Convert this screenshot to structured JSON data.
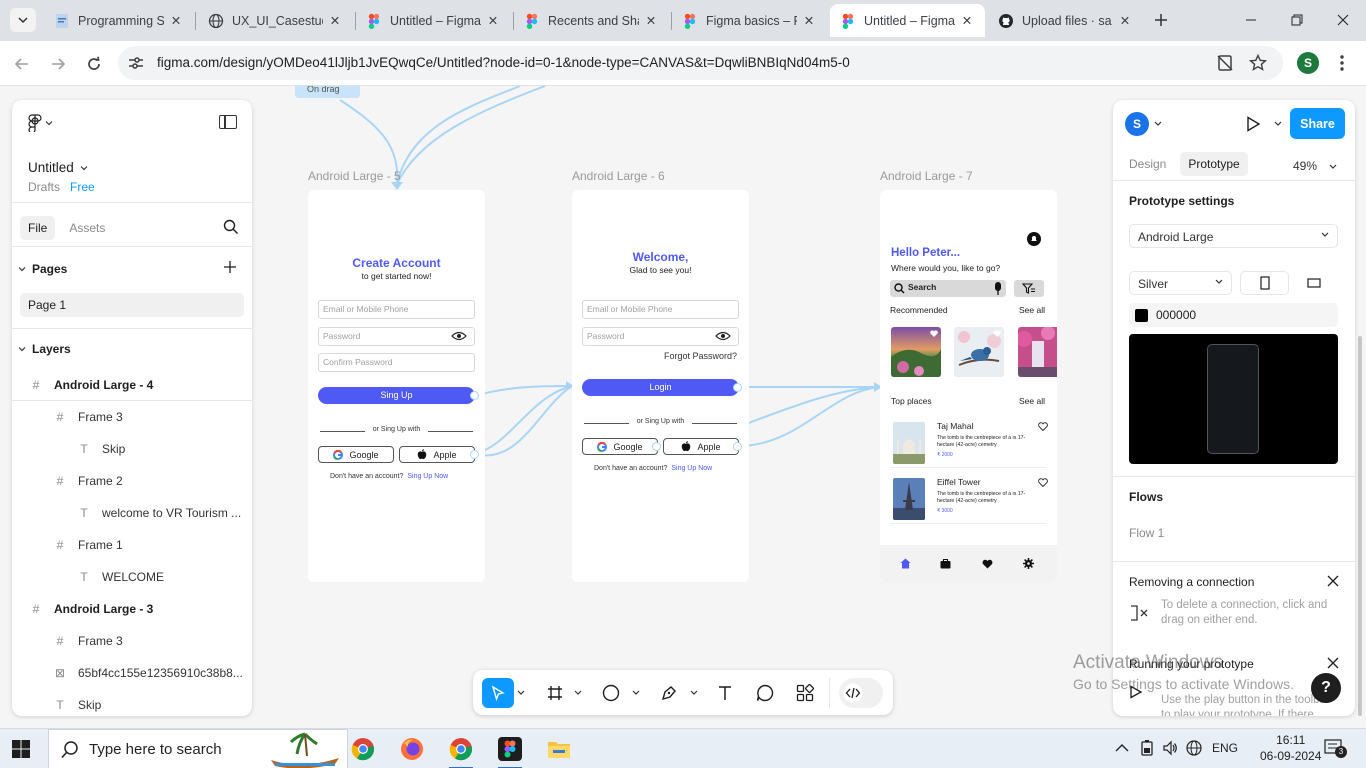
{
  "browser": {
    "tabs": [
      {
        "title": "Programming Sk",
        "icon": "generic-page-icon"
      },
      {
        "title": "UX_UI_Casestud",
        "icon": "globe-icon"
      },
      {
        "title": "Untitled – Figma",
        "icon": "figma-icon"
      },
      {
        "title": "Recents and Sha",
        "icon": "figma-icon"
      },
      {
        "title": "Figma basics – F",
        "icon": "figma-icon"
      },
      {
        "title": "Untitled – Figma",
        "icon": "figma-icon",
        "active": true
      },
      {
        "title": "Upload files · sa",
        "icon": "github-icon"
      }
    ],
    "url": "figma.com/design/yOMDeo41lJljb1JvEQwqCe/Untitled?node-id=0-1&node-type=CANVAS&t=DqwliBNBIqNd04m5-0",
    "profile_initial": "S"
  },
  "left_panel": {
    "file_name": "Untitled",
    "location": "Drafts",
    "plan": "Free",
    "tabs": [
      "File",
      "Assets"
    ],
    "pages_label": "Pages",
    "pages": [
      "Page 1"
    ],
    "layers_label": "Layers",
    "layers": [
      {
        "name": "Android Large - 4",
        "kind": "frame",
        "level": 0
      },
      {
        "name": "Frame 3",
        "kind": "frame",
        "level": 1
      },
      {
        "name": "Skip",
        "kind": "text",
        "level": 2
      },
      {
        "name": "Frame 2",
        "kind": "frame",
        "level": 1
      },
      {
        "name": "welcome to VR Tourism ...",
        "kind": "text",
        "level": 2
      },
      {
        "name": "Frame 1",
        "kind": "frame",
        "level": 1
      },
      {
        "name": "WELCOME",
        "kind": "text",
        "level": 2
      },
      {
        "name": "Android Large - 3",
        "kind": "frame",
        "level": 0
      },
      {
        "name": "Frame 3",
        "kind": "frame",
        "level": 1
      },
      {
        "name": "65bf4cc155e12356910c38b8...",
        "kind": "image",
        "level": 1
      },
      {
        "name": "Skip",
        "kind": "text",
        "level": 1
      }
    ]
  },
  "canvas": {
    "top_chip": "On drag",
    "frames": {
      "f5": {
        "label": "Android Large - 5",
        "title": "Create Account",
        "subtitle": "to get started now!",
        "email_placeholder": "Email or Mobile Phone",
        "password_placeholder": "Password",
        "confirm_placeholder": "Confirm Password",
        "primary_button": "Sing Up",
        "divider": "or Sing Up with",
        "google": "Google",
        "apple": "Apple",
        "footer_text": "Don't have an account?",
        "footer_link": "Sing Up Now"
      },
      "f6": {
        "label": "Android Large - 6",
        "title": "Welcome,",
        "subtitle": "Glad to see you!",
        "email_placeholder": "Email or Mobile Phone",
        "password_placeholder": "Password",
        "forgot": "Forgot Password?",
        "primary_button": "Login",
        "divider": "or Sing Up with",
        "google": "Google",
        "apple": "Apple",
        "footer_text": "Don't have an account?",
        "footer_link": "Sing Up Now"
      },
      "f7": {
        "label": "Android Large - 7",
        "greeting": "Hello Peter...",
        "question": "Where would you, like to go?",
        "search": "Search",
        "recommended": "Recommended",
        "see_all": "See all",
        "top_places": "Top places",
        "places": [
          {
            "name": "Taj Mahal",
            "desc": "The tomb is the centrepiece of a is 17-hectare (42-acre) cemetry",
            "price": "₹ 2000"
          },
          {
            "name": "Eiffel Tower",
            "desc": "The tomb is the centrepiece of a is 17-hectare (42-acre) cemetry",
            "price": "₹ 3000"
          }
        ],
        "nav_icons": [
          "home-icon",
          "bag-icon",
          "heart-icon",
          "gear-icon"
        ]
      }
    }
  },
  "toolbar_tools": [
    "move-tool",
    "frame-tool",
    "shape-tool",
    "pen-tool",
    "text-tool",
    "comment-tool",
    "actions-tool",
    "dev-mode-toggle"
  ],
  "right_panel": {
    "avatar_initial": "S",
    "share_label": "Share",
    "tabs": [
      "Design",
      "Prototype"
    ],
    "active_tab": "Prototype",
    "zoom": "49%",
    "prototype_settings_label": "Prototype settings",
    "device": "Android Large",
    "device_color": "Silver",
    "background_hex": "000000",
    "flows_label": "Flows",
    "flow_item": "Flow 1",
    "removing_title": "Removing a connection",
    "removing_text": "To delete a connection, click and drag on either end.",
    "running_title": "Running your prototype",
    "running_text": "Use the play button in the toolbar to play your prototype. If there"
  },
  "watermark": {
    "line1": "Activate Windows",
    "line2": "Go to Settings to activate Windows."
  },
  "taskbar": {
    "search_placeholder": "Type here to search",
    "language": "ENG",
    "time": "16:11",
    "date": "06-09-2024",
    "notifications": "3"
  },
  "colors": {
    "figma_blue": "#0d99ff",
    "mockup_accent": "#4f5af5",
    "connector": "#a9d5f5"
  }
}
